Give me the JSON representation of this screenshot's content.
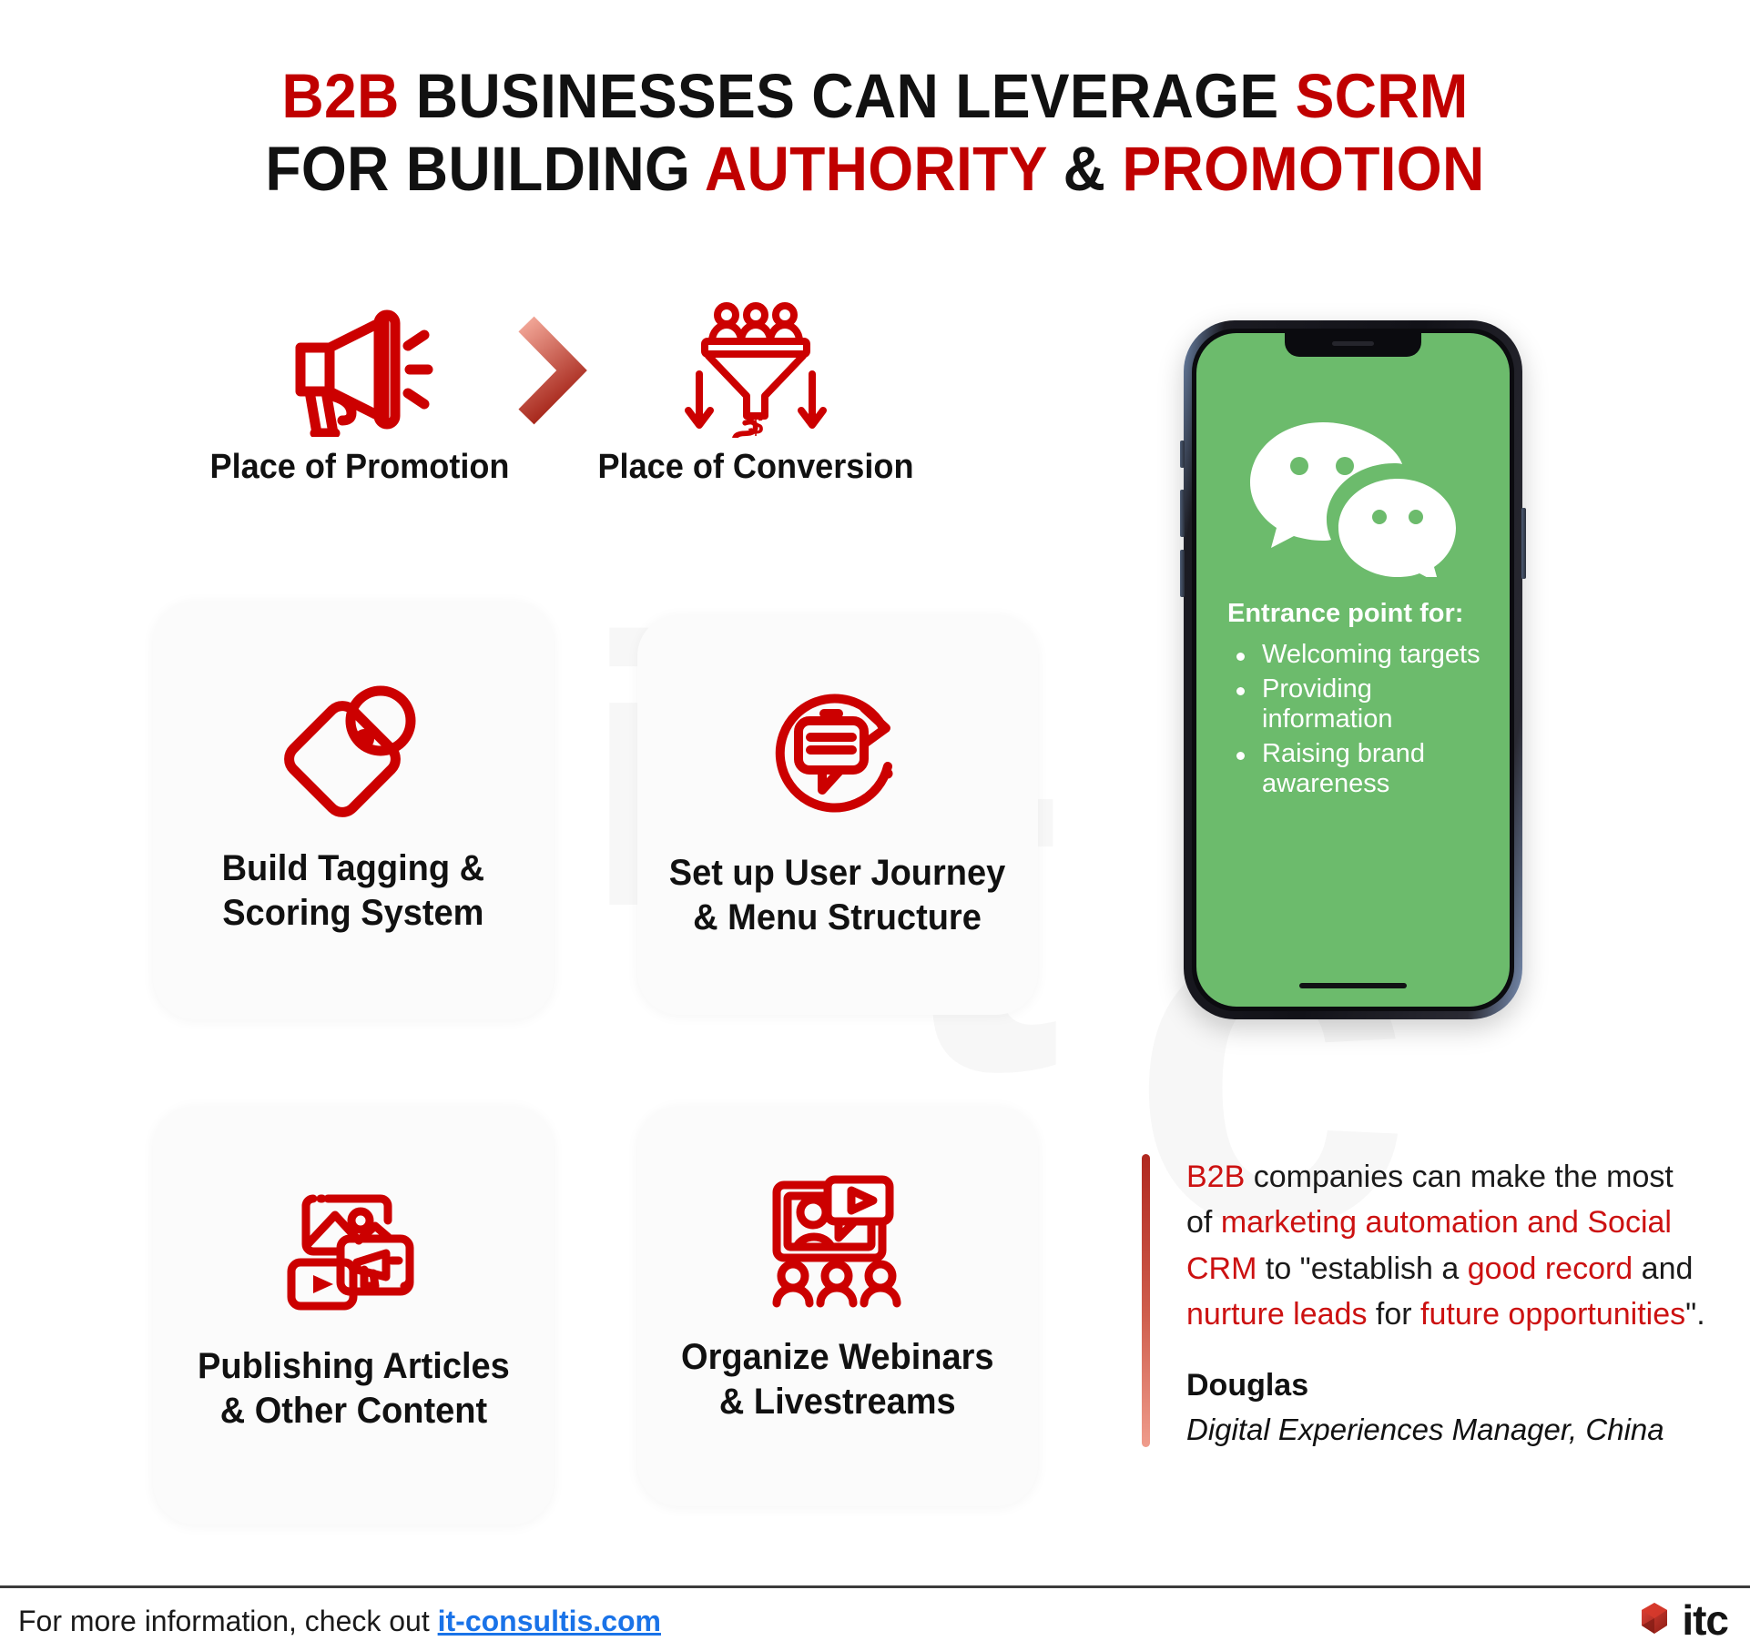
{
  "title": {
    "line1_part1": "B2B",
    "line1_part2": " BUSINESSES CAN LEVERAGE ",
    "line1_part3": "SCRM",
    "line2_part1": "FOR BUILDING ",
    "line2_part2": "AUTHORITY",
    "line2_part3": " & ",
    "line2_part4": "PROMOTION"
  },
  "flow": {
    "left_label": "Place of Promotion",
    "right_label": "Place of Conversion",
    "left_icon": "megaphone-icon",
    "right_icon": "conversion-funnel-icon",
    "arrow_icon": "chevron-right-icon"
  },
  "cards": [
    {
      "id": "tag",
      "icon": "price-tag-icon",
      "line1": "Build Tagging &",
      "line2": "Scoring System"
    },
    {
      "id": "journey",
      "icon": "chat-refresh-icon",
      "line1": "Set up User Journey",
      "line2": "& Menu Structure"
    },
    {
      "id": "publish",
      "icon": "media-content-icon",
      "line1": "Publishing Articles",
      "line2": "& Other Content"
    },
    {
      "id": "webinar",
      "icon": "webinar-screen-icon",
      "line1": "Organize Webinars",
      "line2": "& Livestreams"
    }
  ],
  "phone": {
    "app_icon": "wechat-logo-icon",
    "heading": "Entrance point for:",
    "bullets": [
      "Welcoming targets",
      "Providing information",
      "Raising brand awareness"
    ]
  },
  "quote": {
    "seg1": "B2B",
    "seg2": " companies can make the most of ",
    "seg3": "marketing automation and Social CRM",
    "seg4": " to \"establish a ",
    "seg5": "good record",
    "seg6": " and ",
    "seg7": "nurture leads",
    "seg8": " for ",
    "seg9": "future opportunities",
    "seg10": "\".",
    "name": "Douglas",
    "role": "Digital Experiences Manager, China"
  },
  "footer": {
    "text": "For more information, check out ",
    "link": "it-consultis.com",
    "logo_text": "itc",
    "logo_icon": "itc-polygon-icon"
  },
  "watermark": {
    "i": "i",
    "t": "t",
    "c": "c"
  },
  "colors": {
    "brand_red": "#c00000",
    "accent_red": "#cc1111",
    "wechat_green": "#6cbb6c",
    "link_blue": "#1a73e8"
  }
}
